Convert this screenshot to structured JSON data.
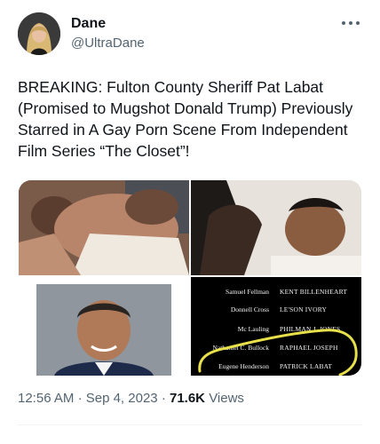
{
  "tweet": {
    "display_name": "Dane",
    "handle": "@UltraDane",
    "more_icon": "more-horizontal-icon",
    "text": "BREAKING: Fulton County Sheriff Pat Labat (Promised to Mugshot Donald Trump) Previously Starred in A Gay Porn Scene From Independent Film Series “The Closet”!",
    "time": "12:56 AM",
    "separator": "·",
    "date": "Sep 4, 2023",
    "views_count": "71.6K",
    "views_label": "Views"
  },
  "credits": [
    {
      "left": "Samuel Fellman",
      "right": "KENT BILLENHEART"
    },
    {
      "left": "Donnell Cross",
      "right": "LE'SON IVORY"
    },
    {
      "left": "Mc Lauling",
      "right": "PHILMAN J. JONES"
    },
    {
      "left": "Nathaniel C. Bullock",
      "right": "RAPHAEL JOSEPH"
    },
    {
      "left": "Eugene Henderson",
      "right": "PATRICK LABAT"
    }
  ],
  "colors": {
    "text_primary": "#0f1419",
    "text_secondary": "#536471",
    "highlight_circle": "#e8e04a"
  }
}
